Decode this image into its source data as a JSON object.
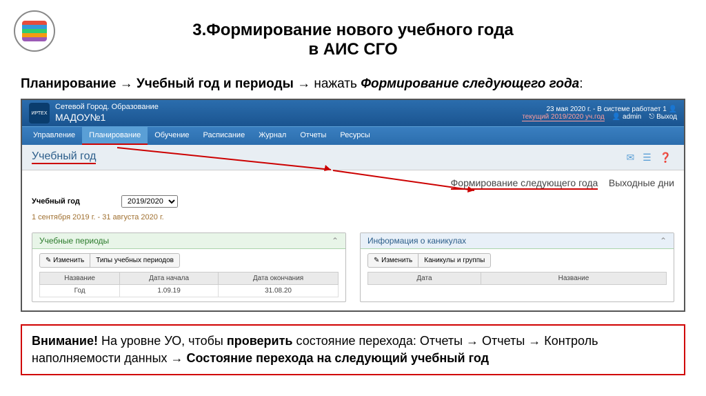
{
  "slide": {
    "title_line1": "3.Формирование нового учебного года",
    "title_line2": "в АИС СГО"
  },
  "subtitle": {
    "part1": "Планирование",
    "arrow": "→",
    "part2": "Учебный год и периоды",
    "part3_prefix": "нажать ",
    "part3_italic": "Формирование следующего года",
    "colon": ":"
  },
  "app": {
    "system_name": "Сетевой Город. Образование",
    "org_name": "МАДОУ№1",
    "logo_text": "ИРТЕХ",
    "header_right_1": "23 мая 2020 г. - В системе работает 1 👤",
    "current_year": "текущий 2019/2020 уч.год",
    "admin_label": "👤 admin",
    "exit_label": "⎋ Выход",
    "menu": [
      "Управление",
      "Планирование",
      "Обучение",
      "Расписание",
      "Журнал",
      "Отчеты",
      "Ресурсы"
    ],
    "active_menu_index": 1,
    "page_title": "Учебный год",
    "page_icons": "✉ ☰ ❓",
    "links": {
      "form_next": "Формирование следующего года",
      "weekends": "Выходные дни"
    },
    "year_label": "Учебный год",
    "year_value": "2019/2020",
    "year_range": "1 сентября 2019 г. - 31 августа 2020 г."
  },
  "panels": {
    "periods": {
      "title": "Учебные периоды",
      "btn_edit": "✎ Изменить",
      "btn_types": "Типы учебных периодов",
      "cols": [
        "Название",
        "Дата начала",
        "Дата окончания"
      ],
      "rows": [
        [
          "Год",
          "1.09.19",
          "31.08.20"
        ]
      ]
    },
    "holidays": {
      "title": "Информация о каникулах",
      "btn_edit": "✎ Изменить",
      "btn_groups": "Каникулы и группы",
      "cols": [
        "Дата",
        "Название"
      ]
    }
  },
  "attention": {
    "lead": "Внимание!",
    "t1": " На уровне УО, чтобы ",
    "b1": "проверить",
    "t2": " состояние перехода: Отчеты → Отчеты → Контроль наполняемости данных → ",
    "b2": "Состояние перехода на следующий учебный год"
  }
}
